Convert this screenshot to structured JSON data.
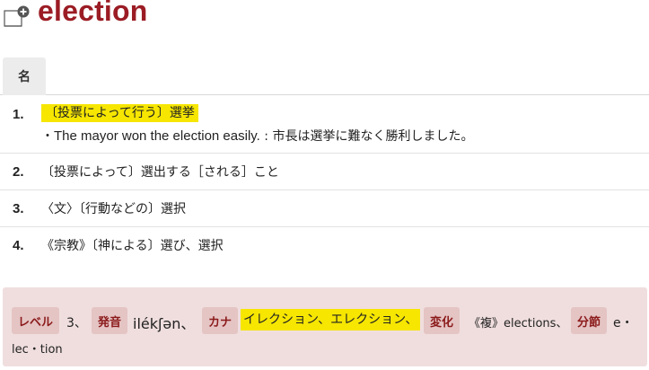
{
  "header": {
    "title": "election",
    "add_icon": "add-to-wordbook-icon"
  },
  "tabs": [
    {
      "label": "名"
    }
  ],
  "senses": [
    {
      "number": "1.",
      "definition": "〔投票によって行う〕選挙",
      "highlighted": true,
      "example_prefix": "・",
      "example_en": "The mayor won the election easily.",
      "example_sep": " : ",
      "example_ja": "市長は選挙に難なく勝利しました。"
    },
    {
      "number": "2.",
      "definition": "〔投票によって〕選出する［される］こと"
    },
    {
      "number": "3.",
      "definition": "〈文〉〔行動などの〕選択"
    },
    {
      "number": "4.",
      "definition": "《宗教》〔神による〕選び、選択"
    }
  ],
  "info": {
    "level_label": "レベル",
    "level_value": "3、",
    "pron_label": "発音",
    "pron_value": "ilékʃən、",
    "kana_label": "カナ",
    "kana_value": "イレクション、エレクション、",
    "change_label": "変化",
    "change_value": "《複》elections、",
    "syllable_label": "分節",
    "syllable_value_1": "e・",
    "syllable_value_2": "lec・tion"
  },
  "colors": {
    "title": "#9b1c24",
    "highlight": "#f6e600",
    "info_bg": "#f0dede",
    "tag_bg": "#e5c4c4",
    "tag_text": "#8b1a1a"
  }
}
